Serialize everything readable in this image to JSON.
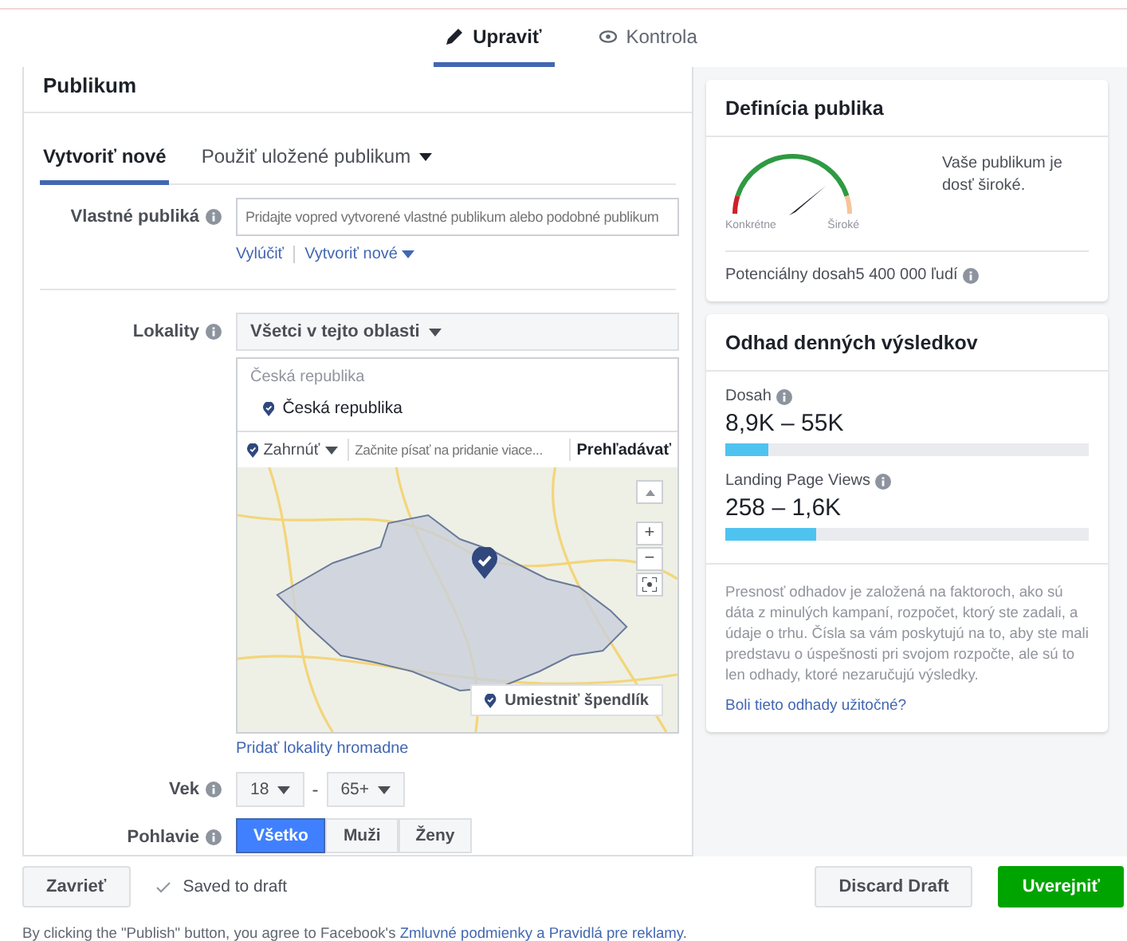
{
  "tabs": [
    {
      "label": "Upraviť",
      "kind": "edit",
      "selected": true
    },
    {
      "label": "Kontrola",
      "kind": "review",
      "selected": false
    }
  ],
  "audience": {
    "title": "Publikum",
    "tabs": [
      {
        "label": "Vytvoriť nové",
        "selected": true,
        "dropdown": false
      },
      {
        "label": "Použiť uložené publikum",
        "selected": false,
        "dropdown": true
      }
    ],
    "custom_audiences": {
      "label": "Vlastné publiká",
      "placeholder": "Pridajte vopred vytvorené vlastné publikum alebo podobné publikum",
      "links": [
        "Vylúčiť",
        "Vytvoriť nové"
      ]
    },
    "locations": {
      "label": "Lokality",
      "scope": "Všetci v tejto oblasti",
      "group": "Česká republika",
      "items": [
        "Česká republika"
      ],
      "mode": "Zahrnúť",
      "search_placeholder": "Začnite písať na pridanie viace...",
      "browse": "Prehľadávať",
      "zoom_in": "+",
      "zoom_out": "−",
      "pin_button": "Umiestniť špendlík",
      "bulk_link": "Pridať lokality hromadne"
    },
    "age": {
      "label": "Vek",
      "from": "18",
      "separator": "-",
      "to": "65+"
    },
    "gender": {
      "label": "Pohlavie",
      "options": [
        {
          "label": "Všetko",
          "selected": true
        },
        {
          "label": "Muži",
          "selected": false
        },
        {
          "label": "Ženy",
          "selected": false
        }
      ]
    }
  },
  "definition": {
    "title": "Definícia publika",
    "gauge_left": "Konkrétne",
    "gauge_right": "Široké",
    "summary": "Vaše publikum je dosť široké.",
    "potential_reach": "Potenciálny dosah5 400 000 ľudí"
  },
  "estimates": {
    "title": "Odhad denných výsledkov",
    "metrics": [
      {
        "label": "Dosah",
        "value": "8,9K – 55K",
        "level": 0.12
      },
      {
        "label": "Landing Page Views",
        "value": "258 – 1,6K",
        "level": 0.25
      }
    ],
    "note": "Presnosť odhadov je založená na faktoroch, ako sú dáta z minulých kampaní, rozpočet, ktorý ste zadali, a údaje o trhu. Čísla sa vám poskytujú na to, aby ste mali predstavu o úspešnosti pri svojom rozpočte, ale sú to len odhady, ktoré nezaručujú výsledky.",
    "feedback_link": "Boli tieto odhady užitočné?"
  },
  "footer": {
    "close": "Zavrieť",
    "status": "Saved to draft",
    "discard": "Discard Draft",
    "publish": "Uverejniť",
    "legal": {
      "text": "By clicking the \"Publish\" button, you agree to Facebook's",
      "link": "Zmluvné podmienky a Pravidlá pre reklamy",
      "end": "."
    }
  }
}
